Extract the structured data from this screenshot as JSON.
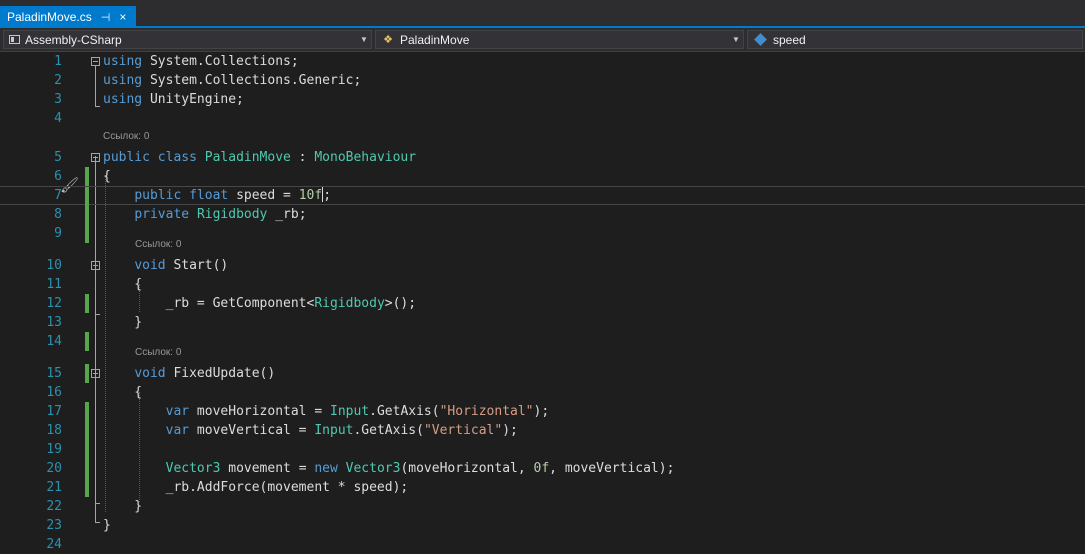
{
  "tab": {
    "title": "PaladinMove.cs",
    "pin": "⊣",
    "close": "×"
  },
  "nav": {
    "project": "Assembly-CSharp",
    "type": "PaladinMove",
    "member": "speed"
  },
  "code_lens": "Ссылок: 0",
  "lines": [
    {
      "num": "1",
      "tokens": [
        [
          "kw",
          "using"
        ],
        [
          "pl",
          " System.Collections;"
        ]
      ]
    },
    {
      "num": "2",
      "tokens": [
        [
          "kw",
          "using"
        ],
        [
          "pl",
          " System.Collections.Generic;"
        ]
      ]
    },
    {
      "num": "3",
      "tokens": [
        [
          "kw",
          "using"
        ],
        [
          "pl",
          " UnityEngine;"
        ]
      ]
    },
    {
      "num": "4",
      "tokens": []
    },
    {
      "num": "5",
      "tokens": [
        [
          "kw",
          "public"
        ],
        [
          "pl",
          " "
        ],
        [
          "kw",
          "class"
        ],
        [
          "pl",
          " "
        ],
        [
          "ty",
          "PaladinMove"
        ],
        [
          "pl",
          " : "
        ],
        [
          "ty",
          "MonoBehaviour"
        ]
      ]
    },
    {
      "num": "6",
      "tokens": [
        [
          "pl",
          "{"
        ]
      ]
    },
    {
      "num": "7",
      "tokens": [
        [
          "pl",
          "    "
        ],
        [
          "kw",
          "public"
        ],
        [
          "pl",
          " "
        ],
        [
          "kw",
          "float"
        ],
        [
          "pl",
          " speed = "
        ],
        [
          "nu",
          "10f"
        ],
        [
          "caret",
          ""
        ],
        [
          "pl",
          ";"
        ]
      ]
    },
    {
      "num": "8",
      "tokens": [
        [
          "pl",
          "    "
        ],
        [
          "kw",
          "private"
        ],
        [
          "pl",
          " "
        ],
        [
          "ty",
          "Rigidbody"
        ],
        [
          "pl",
          " _rb;"
        ]
      ]
    },
    {
      "num": "9",
      "tokens": []
    },
    {
      "num": "10",
      "tokens": [
        [
          "pl",
          "    "
        ],
        [
          "kw",
          "void"
        ],
        [
          "pl",
          " Start()"
        ]
      ]
    },
    {
      "num": "11",
      "tokens": [
        [
          "pl",
          "    {"
        ]
      ]
    },
    {
      "num": "12",
      "tokens": [
        [
          "pl",
          "        _rb = GetComponent<"
        ],
        [
          "ty",
          "Rigidbody"
        ],
        [
          "pl",
          ">();"
        ]
      ]
    },
    {
      "num": "13",
      "tokens": [
        [
          "pl",
          "    }"
        ]
      ]
    },
    {
      "num": "14",
      "tokens": []
    },
    {
      "num": "15",
      "tokens": [
        [
          "pl",
          "    "
        ],
        [
          "kw",
          "void"
        ],
        [
          "pl",
          " FixedUpdate()"
        ]
      ]
    },
    {
      "num": "16",
      "tokens": [
        [
          "pl",
          "    {"
        ]
      ]
    },
    {
      "num": "17",
      "tokens": [
        [
          "pl",
          "        "
        ],
        [
          "kw",
          "var"
        ],
        [
          "pl",
          " moveHorizontal = "
        ],
        [
          "ty",
          "Input"
        ],
        [
          "pl",
          ".GetAxis("
        ],
        [
          "st",
          "\"Horizontal\""
        ],
        [
          "pl",
          ");"
        ]
      ]
    },
    {
      "num": "18",
      "tokens": [
        [
          "pl",
          "        "
        ],
        [
          "kw",
          "var"
        ],
        [
          "pl",
          " moveVertical = "
        ],
        [
          "ty",
          "Input"
        ],
        [
          "pl",
          ".GetAxis("
        ],
        [
          "st",
          "\"Vertical\""
        ],
        [
          "pl",
          ");"
        ]
      ]
    },
    {
      "num": "19",
      "tokens": []
    },
    {
      "num": "20",
      "tokens": [
        [
          "pl",
          "        "
        ],
        [
          "ty",
          "Vector3"
        ],
        [
          "pl",
          " movement = "
        ],
        [
          "kw",
          "new"
        ],
        [
          "pl",
          " "
        ],
        [
          "ty",
          "Vector3"
        ],
        [
          "pl",
          "(moveHorizontal, "
        ],
        [
          "nu",
          "0f"
        ],
        [
          "pl",
          ", moveVertical);"
        ]
      ]
    },
    {
      "num": "21",
      "tokens": [
        [
          "pl",
          "        _rb.AddForce(movement * speed);"
        ]
      ]
    },
    {
      "num": "22",
      "tokens": [
        [
          "pl",
          "    }"
        ]
      ]
    },
    {
      "num": "23",
      "tokens": [
        [
          "pl",
          "}"
        ]
      ]
    },
    {
      "num": "24",
      "tokens": []
    }
  ]
}
